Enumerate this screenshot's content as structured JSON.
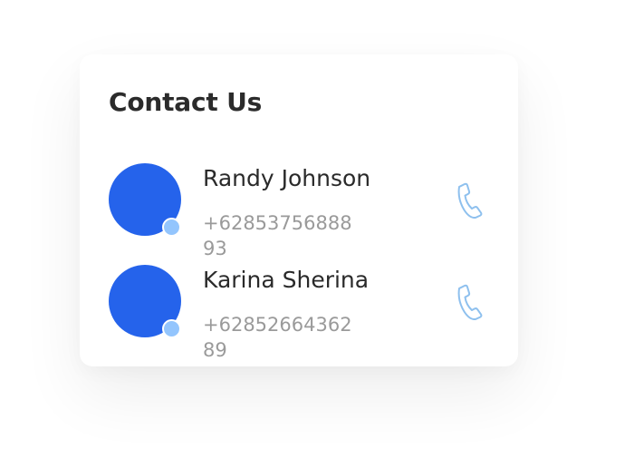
{
  "card": {
    "title": "Contact Us"
  },
  "contacts": [
    {
      "name": "Randy Johnson",
      "phone": "+6285375688893",
      "avatar_color": "#2563eb",
      "status_color": "#93c5fd",
      "action_icon": "phone-icon"
    },
    {
      "name": "Karina Sherina",
      "phone": "+6285266436289",
      "avatar_color": "#2563eb",
      "status_color": "#93c5fd",
      "action_icon": "phone-icon"
    }
  ],
  "colors": {
    "accent": "#2563eb",
    "status": "#93c5fd",
    "icon": "#8ec0ee",
    "title": "#2b2b2b",
    "muted_text": "#9a9a9a"
  }
}
